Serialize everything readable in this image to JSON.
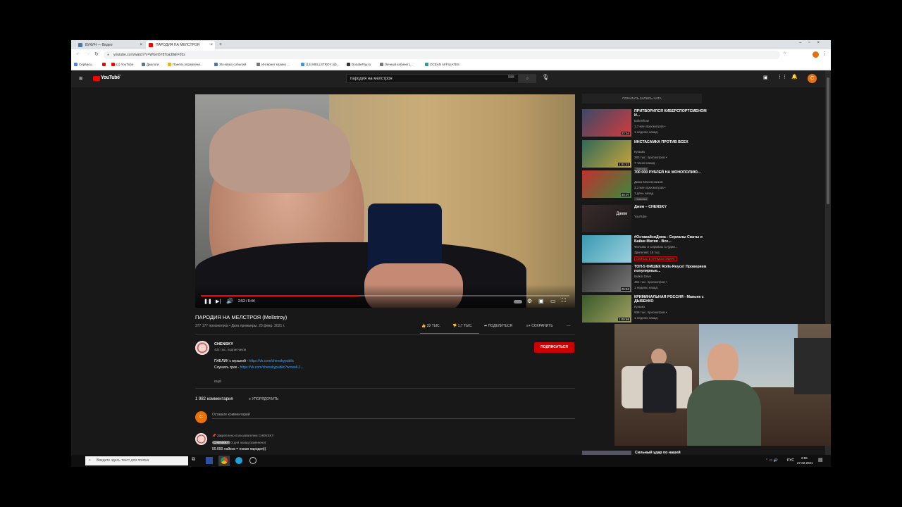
{
  "browser": {
    "tabs": [
      {
        "label": "ВУКИЧ — Видео",
        "color": "#4a76a8"
      },
      {
        "label": "ПАРОДИЯ НА МЕЛСТРОЯ",
        "color": "#ff0000"
      }
    ],
    "new_tab": "+",
    "url": "youtube.com/watch?v=WGm578Toa38&t=20s",
    "bookmarks": [
      {
        "label": "Сервисы",
        "color": "#4285f4"
      },
      {
        "label": "",
        "color": "#ff0000"
      },
      {
        "label": "(1) YouTube",
        "color": "#ff0000"
      },
      {
        "label": "Диалоги",
        "color": "#4a76a8"
      },
      {
        "label": "Панель управлени...",
        "color": "#f4b400"
      },
      {
        "label": "36 новых событий",
        "color": "#4a76a8"
      },
      {
        "label": "Интернет казино ...",
        "color": "#777"
      },
      {
        "label": "(13) MELLSTROY (@...",
        "color": "#1da1f2"
      },
      {
        "label": "DonatePay.ru",
        "color": "#333"
      },
      {
        "label": "Личный кабинет |...",
        "color": "#777"
      },
      {
        "label": "OCEAN AFFILIATES",
        "color": "#1aa"
      }
    ]
  },
  "youtube": {
    "logo": "YouTube",
    "logo_suffix": "RU",
    "search_value": "пародия на мелстроя",
    "avatar_letter": "C",
    "player": {
      "time": "2:52 / 6:44",
      "progress": 0.43
    },
    "video": {
      "title": "ПАРОДИЯ НА МЕЛСТРОЯ (Mellstroy)",
      "meta": "377 177 просмотров • Дата премьеры: 23 февр. 2021 г.",
      "likes": "39 ТЫС.",
      "dislikes": "1,7 ТЫС.",
      "share": "ПОДЕЛИТЬСЯ",
      "save": "СОХРАНИТЬ",
      "more": "..."
    },
    "channel": {
      "name": "CHENSKY",
      "subs": "432 тыс. подписчиков",
      "subscribe": "ПОДПИСАТЬСЯ",
      "desc1_label": "ПАБЛИК с музыкой - ",
      "desc1_link": "https://vk.com/chenskypublic",
      "desc2_label": "Слушать трек - ",
      "desc2_link": "https://vk.com/chenskypublic?w=wall-1...",
      "more": "ЕЩЁ"
    },
    "comments": {
      "count": "1 982 комментария",
      "sort": "УПОРЯДОЧИТЬ",
      "placeholder": "Оставьте комментарий",
      "pinned": "Закреплено пользователем CHENSKY",
      "author": "CHENSKY",
      "when": "3 дня назад (изменено)",
      "text": "50.000 лайков = новая пародия))"
    },
    "chat_button": "ПОКАЗАТЬ ЗАПИСЬ ЧАТА",
    "sidebar": [
      {
        "title": "ПРИТВОРИЛСЯ КИБЕРСПОРТСМЕНОМ И...",
        "channel": "ExileShow",
        "views": "1,7 млн просмотров •",
        "when": "1 неделю назад",
        "badge": "",
        "duration": "22:34",
        "colors": [
          "#3a4a6a",
          "#d23c3c"
        ]
      },
      {
        "title": "ИНСТАСАМКА ПРОТИВ ВСЕХ",
        "channel": "Кузьма",
        "views": "283 тыс. просмотров •",
        "when": "7 часов назад",
        "badge": "Новинка",
        "duration": "1:01:21",
        "colors": [
          "#2f6a5a",
          "#c8a43a"
        ]
      },
      {
        "title": "700 000 РУБЛЕЙ НА МОНОПОЛИЮ...",
        "channel": "Дима Масленников",
        "views": "3,3 млн просмотров •",
        "when": "1 день назад",
        "badge": "Новинка",
        "duration": "40:07",
        "colors": [
          "#c23030",
          "#3a8a3a"
        ]
      },
      {
        "title": "Джем – CHENSKY",
        "channel": "YouTube",
        "views": "",
        "when": "",
        "badge": "",
        "duration": "",
        "colors": [
          "#3a2a2a",
          "#1a1a1a"
        ],
        "mix": "Джем"
      },
      {
        "title": "#ОставайсяДома - Сериалы Сваты и Байки Митяя - Все...",
        "channel": "Фильмы и Сериалы Студии...",
        "views": "Зрителей: 18 тыс.",
        "when": "",
        "badge": "СЕЙЧАС В ПРЯМОМ ЭФИРЕ",
        "duration": "",
        "colors": [
          "#3a9ab0",
          "#9ad0e0"
        ]
      },
      {
        "title": "ТОП-5 ФИШЕК Rolls-Royce! Проверяем популярные...",
        "channel": "Bulkin Drive",
        "views": "451 тыс. просмотров •",
        "when": "1 неделю назад",
        "badge": "",
        "duration": "25:53",
        "colors": [
          "#2a2a2a",
          "#7a7a7a"
        ]
      },
      {
        "title": "КРИМИНАЛЬНАЯ РОССИЯ - Маньяк с ДЫБЕНКО",
        "channel": "Кузьма",
        "views": "636 тыс. просмотров •",
        "when": "1 неделю назад",
        "badge": "",
        "duration": "1:00:58",
        "colors": [
          "#3a5a2a",
          "#a0a060"
        ]
      }
    ],
    "sidebar_bottom": "Сильный удар по нашей"
  },
  "taskbar": {
    "search_placeholder": "Введите здесь текст для поиска",
    "tray_lang": "РУС",
    "time": "2:55",
    "date": "27.02.2021"
  }
}
